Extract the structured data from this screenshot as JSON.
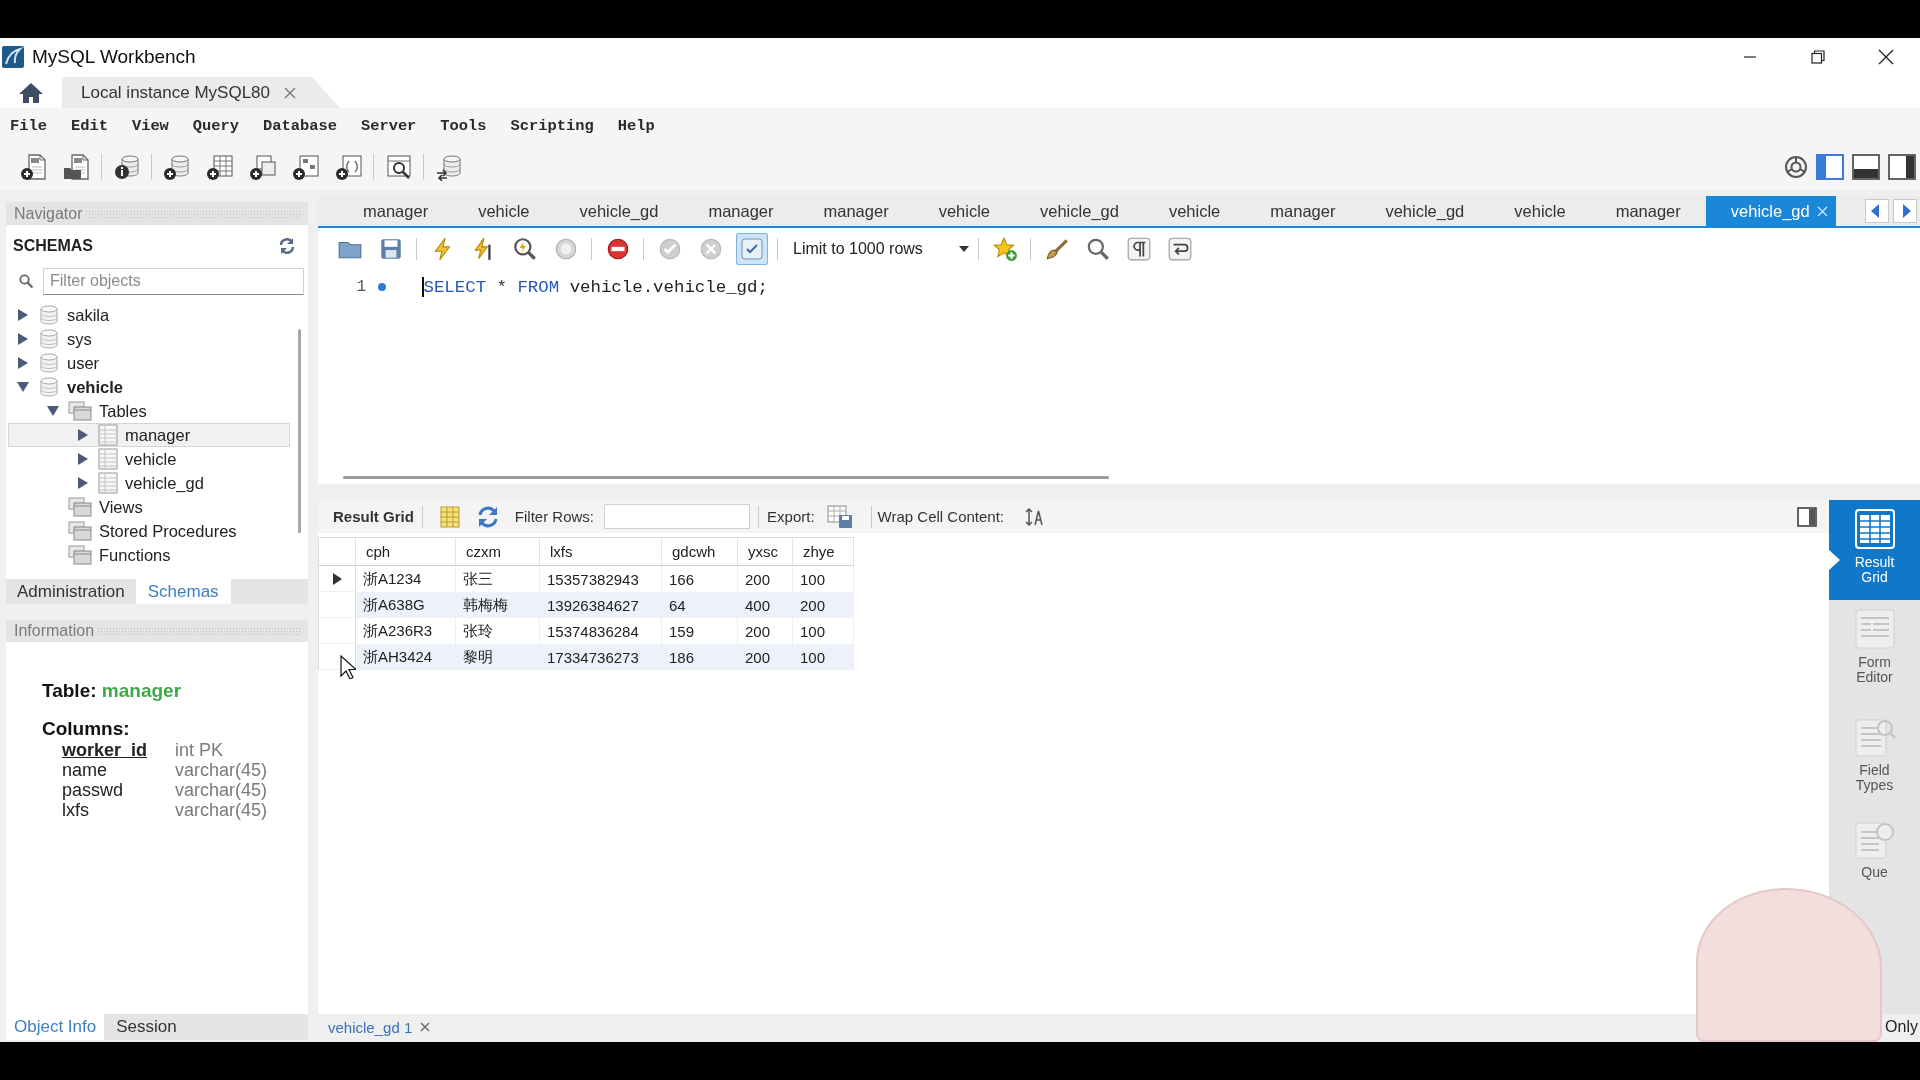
{
  "window": {
    "title": "MySQL Workbench"
  },
  "connection_tabs": [
    {
      "label": "Local instance MySQL80",
      "selected": true
    }
  ],
  "menu": [
    "File",
    "Edit",
    "View",
    "Query",
    "Database",
    "Server",
    "Tools",
    "Scripting",
    "Help"
  ],
  "navigator": {
    "title": "Navigator",
    "schemas_title": "SCHEMAS",
    "filter": {
      "placeholder": "Filter objects"
    },
    "tree": [
      {
        "label": "sakila",
        "kind": "schema",
        "expanded": false,
        "default_schema": false,
        "selected": false
      },
      {
        "label": "sys",
        "kind": "schema",
        "expanded": false,
        "default_schema": false,
        "selected": false
      },
      {
        "label": "user",
        "kind": "schema",
        "expanded": false,
        "default_schema": false,
        "selected": false
      },
      {
        "label": "vehicle",
        "kind": "schema",
        "expanded": true,
        "default_schema": true,
        "selected": false,
        "children": [
          {
            "label": "Tables",
            "kind": "folder",
            "expanded": true,
            "selected": false,
            "children": [
              {
                "label": "manager",
                "kind": "table",
                "expanded": false,
                "selected": true
              },
              {
                "label": "vehicle",
                "kind": "table",
                "expanded": false,
                "selected": false
              },
              {
                "label": "vehicle_gd",
                "kind": "table",
                "expanded": false,
                "selected": false
              }
            ]
          },
          {
            "label": "Views",
            "kind": "folder",
            "selected": false
          },
          {
            "label": "Stored Procedures",
            "kind": "folder",
            "selected": false
          },
          {
            "label": "Functions",
            "kind": "folder",
            "selected": false
          }
        ]
      }
    ],
    "tabs": [
      {
        "label": "Administration",
        "selected": false
      },
      {
        "label": "Schemas",
        "selected": true
      }
    ]
  },
  "information": {
    "title": "Information",
    "object_kind": "Table:",
    "object_name": "manager",
    "columns_title": "Columns:",
    "columns": [
      {
        "name": "worker_id",
        "type": "int PK",
        "primary_key": true
      },
      {
        "name": "name",
        "type": "varchar(45)",
        "primary_key": false
      },
      {
        "name": "passwd",
        "type": "varchar(45)",
        "primary_key": false
      },
      {
        "name": "lxfs",
        "type": "varchar(45)",
        "primary_key": false
      }
    ],
    "tabs": [
      {
        "label": "Object Info",
        "selected": true
      },
      {
        "label": "Session",
        "selected": false
      }
    ]
  },
  "query_tabs": [
    {
      "label": "manager",
      "selected": false
    },
    {
      "label": "vehicle",
      "selected": false
    },
    {
      "label": "vehicle_gd",
      "selected": false
    },
    {
      "label": "manager",
      "selected": false
    },
    {
      "label": "manager",
      "selected": false
    },
    {
      "label": "vehicle",
      "selected": false
    },
    {
      "label": "vehicle_gd",
      "selected": false
    },
    {
      "label": "vehicle",
      "selected": false
    },
    {
      "label": "manager",
      "selected": false
    },
    {
      "label": "vehicle_gd",
      "selected": false
    },
    {
      "label": "vehicle",
      "selected": false
    },
    {
      "label": "manager",
      "selected": false
    },
    {
      "label": "vehicle_gd",
      "selected": true
    }
  ],
  "sql_toolbar": {
    "autocommit": true,
    "limit": "Limit to 1000 rows"
  },
  "editor": {
    "lines": [
      {
        "number": "1",
        "marker": true,
        "tokens": [
          {
            "text": "SELECT",
            "kind": "keyword"
          },
          {
            "text": "*",
            "kind": "operator"
          },
          {
            "text": "FROM",
            "kind": "keyword"
          },
          {
            "text": "vehicle.vehicle_gd;",
            "kind": "identifier"
          }
        ]
      }
    ]
  },
  "result": {
    "title": "Result Grid",
    "filter_label": "Filter Rows:",
    "export_label": "Export:",
    "wrap_label": "Wrap Cell Content:",
    "columns": [
      "cph",
      "czxm",
      "lxfs",
      "gdcwh",
      "yxsc",
      "zhye"
    ],
    "rows": [
      {
        "current": true,
        "cells": [
          "浙A1234",
          "张三",
          "15357382943",
          "166",
          "200",
          "100"
        ]
      },
      {
        "current": false,
        "cells": [
          "浙A638G",
          "韩梅梅",
          "13926384627",
          "64",
          "400",
          "200"
        ]
      },
      {
        "current": false,
        "cells": [
          "浙A236R3",
          "张玲",
          "15374836284",
          "159",
          "200",
          "100"
        ]
      },
      {
        "current": false,
        "cells": [
          "浙AH3424",
          "黎明",
          "17334736273",
          "186",
          "200",
          "100"
        ]
      }
    ]
  },
  "side_panel": [
    {
      "label": "Result Grid",
      "kind": "grid",
      "selected": true
    },
    {
      "label": "Form Editor",
      "kind": "form",
      "selected": false
    },
    {
      "label": "Field Types",
      "kind": "fields",
      "selected": false
    },
    {
      "label": "Que",
      "kind": "stats",
      "selected": false
    }
  ],
  "result_tabs": [
    {
      "label": "vehicle_gd 1",
      "selected": true
    }
  ],
  "status": "Only"
}
